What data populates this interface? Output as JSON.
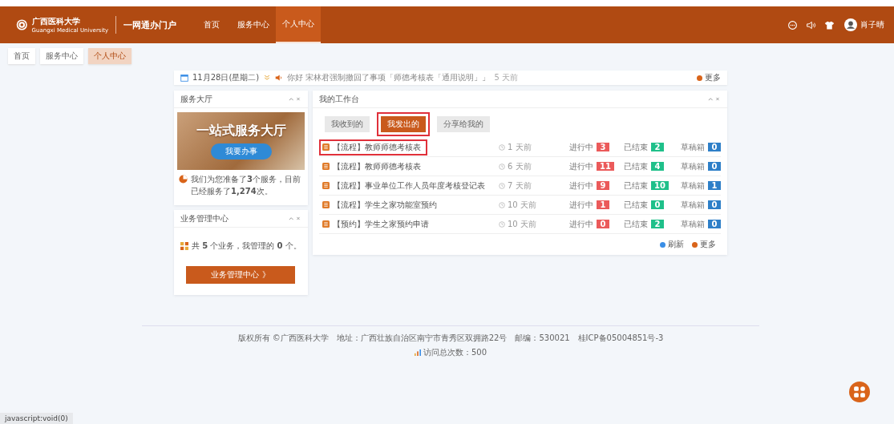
{
  "header": {
    "logo_text": "广西医科大学",
    "logo_subtext": "Guangxi Medical University",
    "portal_title": "一网通办门户",
    "nav": [
      {
        "label": "首页",
        "selected": false
      },
      {
        "label": "服务中心",
        "selected": false
      },
      {
        "label": "个人中心",
        "selected": true
      }
    ],
    "user_name": "肖子晴"
  },
  "breadcrumb_tabs": [
    {
      "label": "首页",
      "selected": false
    },
    {
      "label": "服务中心",
      "selected": false
    },
    {
      "label": "个人中心",
      "selected": true
    }
  ],
  "notice_bar": {
    "date": "11月28日(星期二)",
    "message": "你好 宋林君强制撤回了事项「师德考核表「通用说明」」",
    "time": "5 天前",
    "more": "更多"
  },
  "service_hall": {
    "title": "服务大厅",
    "banner_title": "一站式服务大厅",
    "banner_button": "我要办事",
    "stats": "我们为您准备了**3**个服务，目前已经服务了**1,274**次。"
  },
  "business_center": {
    "title": "业务管理中心",
    "summary": "共 **5** 个业务，我管理的 **0** 个。",
    "button": "业务管理中心 》"
  },
  "workbench": {
    "title": "我的工作台",
    "tabs": [
      {
        "label": "我收到的",
        "selected": false,
        "highlighted": false
      },
      {
        "label": "我发出的",
        "selected": true,
        "highlighted": true
      },
      {
        "label": "分享给我的",
        "selected": false,
        "highlighted": false
      }
    ],
    "rows": [
      {
        "title": "【流程】教师师德考核表",
        "time": "1 天前",
        "highlighted": true,
        "statuses": [
          {
            "kind": "in_progress",
            "label": "进行中",
            "count": "3"
          },
          {
            "kind": "finished",
            "label": "已结束",
            "count": "2"
          },
          {
            "kind": "drafts",
            "label": "草稿箱",
            "count": "0"
          }
        ]
      },
      {
        "title": "【流程】教师师德考核表",
        "time": "6 天前",
        "highlighted": false,
        "statuses": [
          {
            "kind": "in_progress",
            "label": "进行中",
            "count": "11"
          },
          {
            "kind": "finished",
            "label": "已结束",
            "count": "4"
          },
          {
            "kind": "drafts",
            "label": "草稿箱",
            "count": "0"
          }
        ]
      },
      {
        "title": "【流程】事业单位工作人员年度考核登记表",
        "time": "7 天前",
        "highlighted": false,
        "statuses": [
          {
            "kind": "in_progress",
            "label": "进行中",
            "count": "9"
          },
          {
            "kind": "finished",
            "label": "已结束",
            "count": "10"
          },
          {
            "kind": "drafts",
            "label": "草稿箱",
            "count": "1"
          }
        ]
      },
      {
        "title": "【流程】学生之家功能室预约",
        "time": "10 天前",
        "highlighted": false,
        "statuses": [
          {
            "kind": "in_progress",
            "label": "进行中",
            "count": "1"
          },
          {
            "kind": "finished",
            "label": "已结束",
            "count": "0"
          },
          {
            "kind": "drafts",
            "label": "草稿箱",
            "count": "0"
          }
        ]
      },
      {
        "title": "【预约】学生之家预约申请",
        "time": "10 天前",
        "highlighted": false,
        "statuses": [
          {
            "kind": "in_progress",
            "label": "进行中",
            "count": "0"
          },
          {
            "kind": "finished",
            "label": "已结束",
            "count": "2"
          },
          {
            "kind": "drafts",
            "label": "草稿箱",
            "count": "0"
          }
        ]
      }
    ],
    "refresh": "刷新",
    "more": "更多"
  },
  "footer": {
    "copyright": "版权所有 ©广西医科大学　地址：广西壮族自治区南宁市青秀区双拥路22号　邮编：530021　桂ICP备05004851号-3",
    "visits": "访问总次数：500"
  },
  "status_bar": "javascript:void(0)"
}
